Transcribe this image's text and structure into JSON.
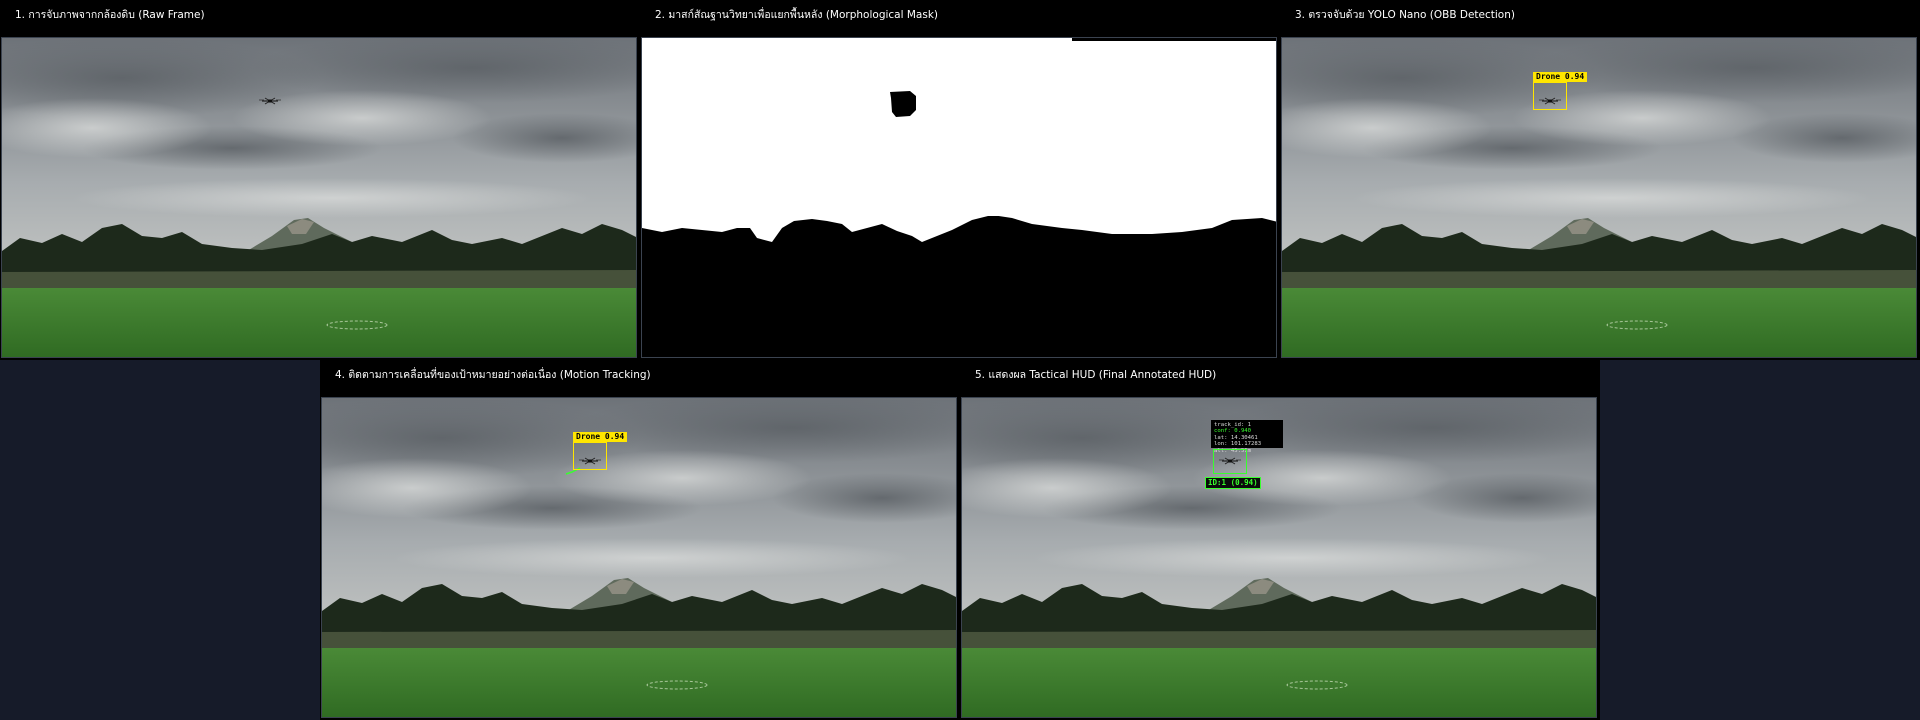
{
  "panels": [
    {
      "label": "1. การจับภาพจากกล้องดิบ (Raw Frame)"
    },
    {
      "label": "2. มาสก์สัณฐานวิทยาเพื่อแยกพื้นหลัง (Morphological Mask)"
    },
    {
      "label": "3. ตรวจจับด้วย YOLO Nano (OBB Detection)"
    },
    {
      "label": "4. ติดตามการเคลื่อนที่ของเป้าหมายอย่างต่อเนื่อง (Motion Tracking)"
    },
    {
      "label": "5. แสดงผล Tactical HUD (Final Annotated HUD)"
    }
  ],
  "detection": {
    "label": "Drone 0.94",
    "class": "Drone",
    "confidence": 0.94
  },
  "hud": {
    "id_label": "ID:1 (0.94)",
    "info_lines": [
      "track_id: 1",
      "conf: 0.940",
      "lat: 14.30461",
      "lon: 101.17283",
      "alt: 45.51m"
    ]
  },
  "colors": {
    "background": "#161b29",
    "detection_box": "#ffe600",
    "track_box": "#39ff2e",
    "sky": "#9da2a6",
    "grass": "#3d7d2d",
    "trees": "#1e2a1c"
  },
  "icons": [
    "drone-icon"
  ]
}
